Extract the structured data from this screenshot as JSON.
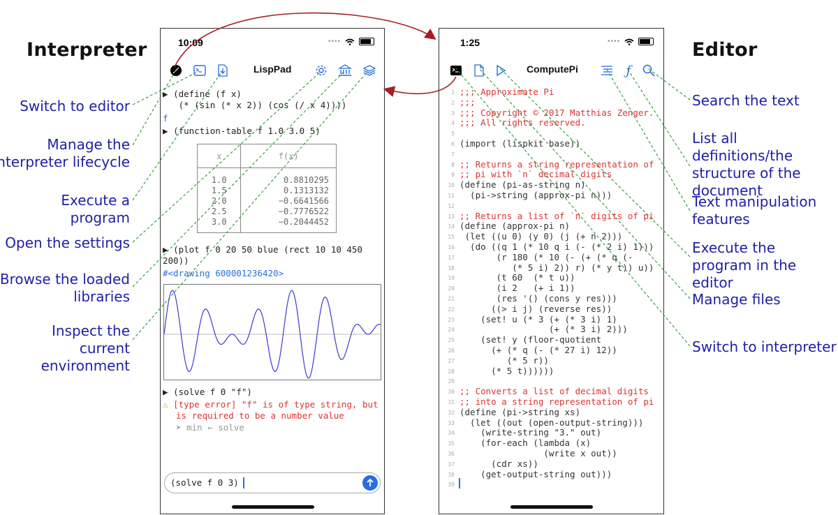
{
  "titles": {
    "interpreter": "Interpreter",
    "editor": "Editor"
  },
  "annotations_left": [
    "Switch to editor",
    "Manage the interpreter lifecycle",
    "Execute a program",
    "Open the settings",
    "Browse the loaded libraries",
    "Inspect the current environment"
  ],
  "annotations_right": [
    "Search the text",
    "List all definitions/the structure of the document",
    "Text manipulation features",
    "Execute the program in the editor",
    "Manage files",
    "Switch to interpreter"
  ],
  "interpreter": {
    "time": "10:09",
    "title": "LispPad",
    "icons": [
      "record-icon",
      "editor-icon",
      "load-icon",
      "gear-icon",
      "library-icon",
      "layers-icon"
    ],
    "repl": [
      {
        "prompt": "▶",
        "text": "(define (f x)"
      },
      {
        "text": "   (* (sin (* x 2)) (cos (/ x 4))))"
      },
      {
        "output": "f"
      },
      {
        "prompt": "▶",
        "text": "(function-table f 1.0 3.0 5)"
      }
    ],
    "table": {
      "headers": [
        "x",
        "f(x)"
      ],
      "rows": [
        [
          "1.0",
          "0.8810295"
        ],
        [
          "1.5",
          "0.1313132"
        ],
        [
          "2.0",
          "−0.6641566"
        ],
        [
          "2.5",
          "−0.7776522"
        ],
        [
          "3.0",
          "−0.2044452"
        ]
      ]
    },
    "plot_cmd_1": "(plot f 0 20 50 blue (rect 10 10 450",
    "plot_cmd_2": "200))",
    "drawing_output": "#<drawing 600001236420>",
    "solve_cmd": "(solve f 0 \"f\")",
    "error_1": "[type error] \"f\" is of type string, but",
    "error_2": "is required to be a number value",
    "trace": "min ← solve",
    "input_value": "(solve f 0 3)"
  },
  "editor": {
    "time": "1:25",
    "title": "ComputePi",
    "icons": [
      "terminal-icon",
      "file-icon",
      "play-icon",
      "list-icon",
      "function-icon",
      "search-icon"
    ],
    "lines": [
      ";;; Approximate Pi",
      ";;;",
      ";;; Copyright © 2017 Matthias Zenger.",
      ";;; All rights reserved.",
      "",
      "(import (lispkit base))",
      "",
      ";; Returns a string representation of",
      ";; pi with `n` decimal digits",
      "(define (pi-as-string n)",
      "  (pi->string (approx-pi n)))",
      "",
      ";; Returns a list of `n` digits of pi",
      "(define (approx-pi n)",
      " (let ((u 0) (y 0) (j (+ n 2)))",
      "  (do ((q 1 (* 10 q i (- (* 2 i) 1)))",
      "       (r 180 (* 10 (- (+ (* q (-",
      "          (* 5 i) 2)) r) (* y t)) u))",
      "       (t 60  (* t u))",
      "       (i 2   (+ i 1))",
      "       (res '() (cons y res)))",
      "      ((> i j) (reverse res))",
      "    (set! u (* 3 (+ (* 3 i) 1)",
      "                 (+ (* 3 i) 2)))",
      "    (set! y (floor-quotient",
      "      (+ (* q (- (* 27 i) 12))",
      "         (* 5 r))",
      "      (* 5 t))))))",
      "",
      ";; Converts a list of decimal digits",
      ";; into a string representation of pi",
      "(define (pi->string xs)",
      "  (let ((out (open-output-string)))",
      "    (write-string \"3.\" out)",
      "    (for-each (lambda (x)",
      "                (write x out))",
      "      (cdr xs))",
      "    (get-output-string out)))",
      ""
    ]
  },
  "colors": {
    "accent": "#2a6ddf",
    "annotation": "#1f1fa6",
    "error": "#d33",
    "leader": "#2a9a30",
    "arrow": "#a61e22"
  }
}
